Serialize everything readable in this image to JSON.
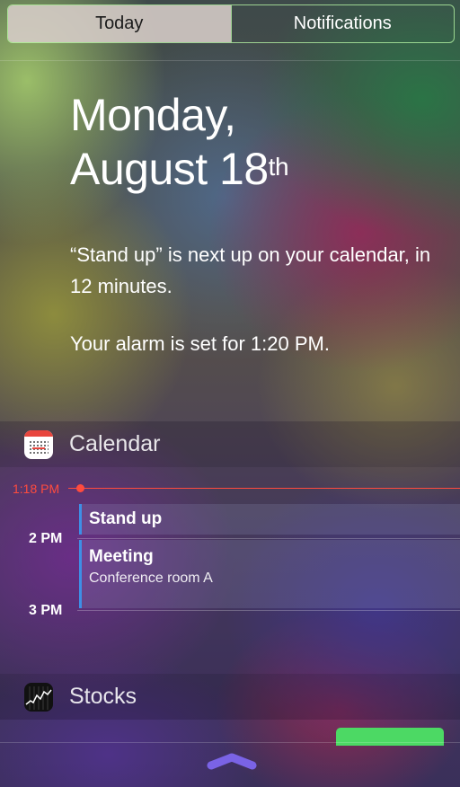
{
  "tabs": {
    "today": "Today",
    "notifications": "Notifications"
  },
  "today_summary": {
    "weekday_line": "Monday,",
    "date_line": "August 18",
    "date_suffix": "th",
    "next_event": "“Stand up” is next up on your calendar, in 12 minutes.",
    "alarm": "Your alarm is set for 1:20 PM."
  },
  "calendar": {
    "header": "Calendar",
    "icon": "calendar-app-icon",
    "current_time": "1:18 PM",
    "hour_labels": [
      "2 PM",
      "3 PM"
    ],
    "events": [
      {
        "title": "Stand up"
      },
      {
        "title": "Meeting",
        "location": "Conference room A"
      }
    ],
    "event_color": "#3e8fe6",
    "now_color": "#ff4b3e"
  },
  "stocks": {
    "header": "Stocks",
    "icon": "stocks-app-icon",
    "accent": "#4cd964"
  },
  "grabber": {
    "icon": "chevron-up-grabber-icon",
    "color": "#7a63e6"
  }
}
